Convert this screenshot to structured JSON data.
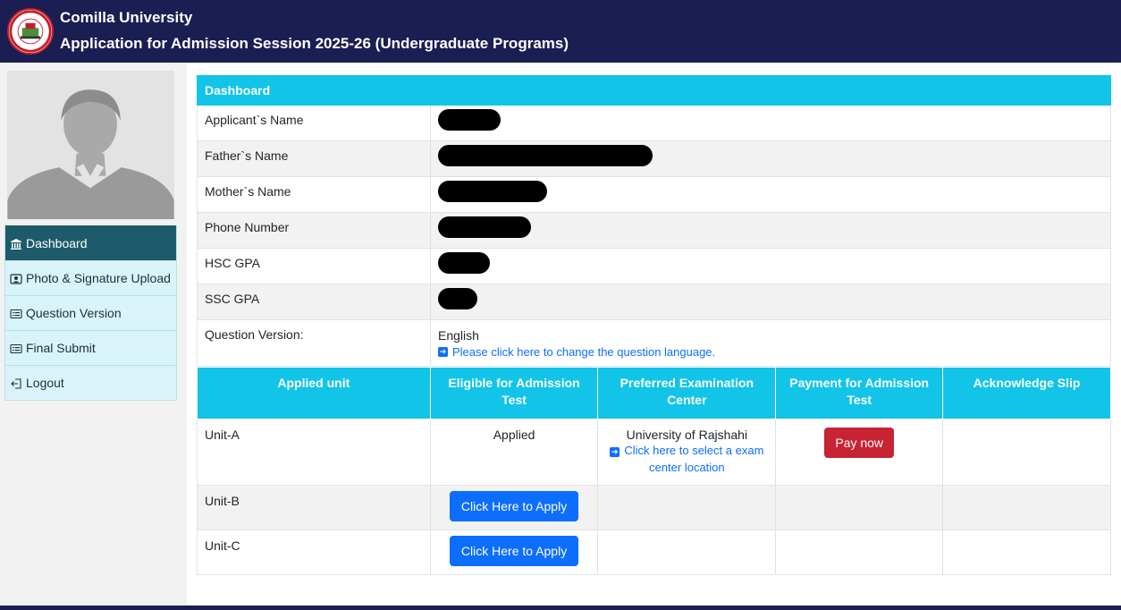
{
  "header": {
    "university": "Comilla University",
    "application_title": "Application for Admission Session 2025-26 (Undergraduate Programs)"
  },
  "sidebar": {
    "items": [
      {
        "label": "Dashboard",
        "icon": "bank-icon",
        "active": true
      },
      {
        "label": "Photo & Signature Upload",
        "icon": "id-badge-icon",
        "active": false
      },
      {
        "label": "Question Version",
        "icon": "card-list-icon",
        "active": false
      },
      {
        "label": "Final Submit",
        "icon": "card-list-icon",
        "active": false
      },
      {
        "label": "Logout",
        "icon": "logout-icon",
        "active": false
      }
    ]
  },
  "dashboard": {
    "heading": "Dashboard",
    "fields": [
      {
        "label": "Applicant`s Name"
      },
      {
        "label": "Father`s Name"
      },
      {
        "label": "Mother`s Name"
      },
      {
        "label": "Phone Number"
      },
      {
        "label": "HSC GPA"
      },
      {
        "label": "SSC GPA"
      }
    ],
    "question_version": {
      "label": "Question Version:",
      "value": "English",
      "change_link": "Please click here to change the question language."
    }
  },
  "units_table": {
    "headers": [
      "Applied unit",
      "Eligible for Admission Test",
      "Preferred Examination Center",
      "Payment for Admission Test",
      "Acknowledge Slip"
    ],
    "rows": [
      {
        "unit": "Unit-A",
        "status": "Applied",
        "center": "University of Rajshahi",
        "center_link": "Click here to select a exam center location",
        "payment": "Pay now"
      },
      {
        "unit": "Unit-B",
        "apply_button": "Click Here to Apply"
      },
      {
        "unit": "Unit-C",
        "apply_button": "Click Here to Apply"
      }
    ]
  },
  "colors": {
    "header_bg": "#1a1e52",
    "table_head": "#11c4e8",
    "active_nav": "#1e5b6a",
    "nav_bg": "#d9f4f9",
    "button_blue": "#0d6efd",
    "button_red": "#c82333"
  }
}
